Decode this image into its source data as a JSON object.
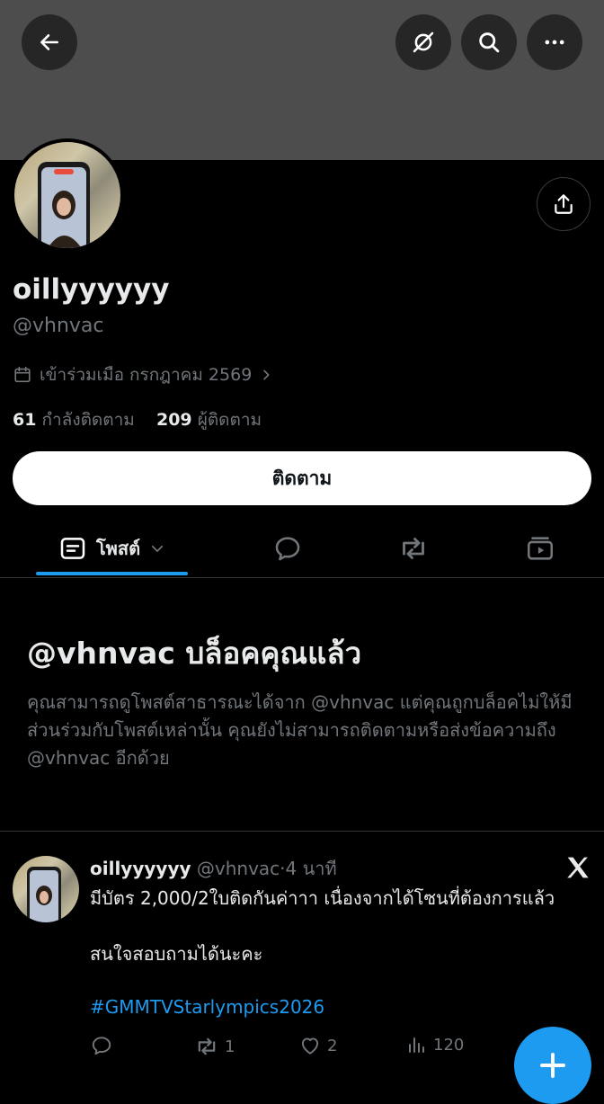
{
  "header": {
    "back_icon": "arrow-left-icon",
    "icons": [
      "hide-icon",
      "search-icon",
      "more-icon"
    ]
  },
  "profile": {
    "display_name": "oillyyyyyy",
    "handle": "@vhnvac",
    "joined": "เข้าร่วมเมือ กรกฎาคม 2569",
    "following_count": "61",
    "following_label": "กำลังติดตาม",
    "followers_count": "209",
    "followers_label": "ผู้ติดตาม",
    "follow_button": "ติดตาม"
  },
  "tabs": {
    "posts_label": "โพสต์",
    "icons": [
      "posts-icon",
      "replies-icon",
      "reposts-icon",
      "media-icon"
    ]
  },
  "blocked": {
    "title": "@vhnvac บล็อคคุณแล้ว",
    "description": "คุณสามารถดูโพสต์สาธารณะได้จาก @vhnvac แต่คุณถูกบล็อคไม่ให้มีส่วนร่วมกับโพสต์เหล่านั้น คุณยังไม่สามารถติดตามหรือส่งข้อความถึง @vhnvac อีกด้วย"
  },
  "post": {
    "author": "oillyyyyyy",
    "handle": "@vhnvac",
    "separator": "·",
    "time": "4 นาที",
    "text": "มีบัตร 2,000/2ใบติดกันค่าาา เนื่องจากได้โซนที่ต้องการแล้ว\n\nสนใจสอบถามได้นะคะ",
    "hashtag": "#GMMTVStarlympics2026",
    "retweets": "1",
    "likes": "2",
    "views": "120"
  },
  "colors": {
    "accent": "#1d9bf0",
    "muted": "#71767b",
    "text": "#e7e9ea",
    "banner": "#4d4d4d"
  }
}
